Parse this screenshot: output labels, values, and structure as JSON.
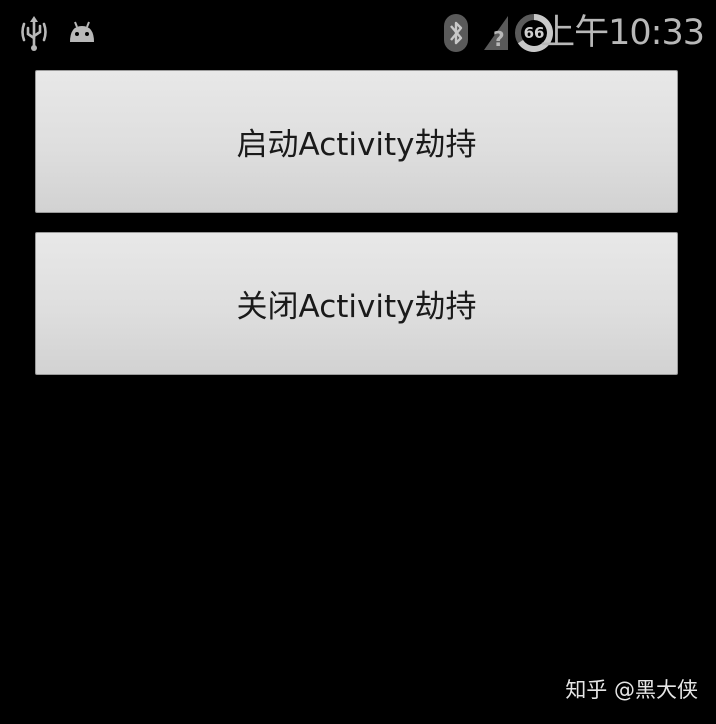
{
  "status_bar": {
    "icons": {
      "usb": "usb-debug-icon",
      "android": "android-icon",
      "bluetooth": "bluetooth-icon",
      "signal": "no-signal-icon",
      "battery": "battery-circle-icon"
    },
    "battery_level": "66",
    "time": "上午10:33"
  },
  "buttons": {
    "start_label": "启动Activity劫持",
    "stop_label": "关闭Activity劫持"
  },
  "watermark": "知乎 @黑大侠",
  "colors": {
    "background": "#000000",
    "button_face": "#dedede",
    "button_text": "#1a1a1a",
    "status_icons": "#b8b8b8"
  }
}
